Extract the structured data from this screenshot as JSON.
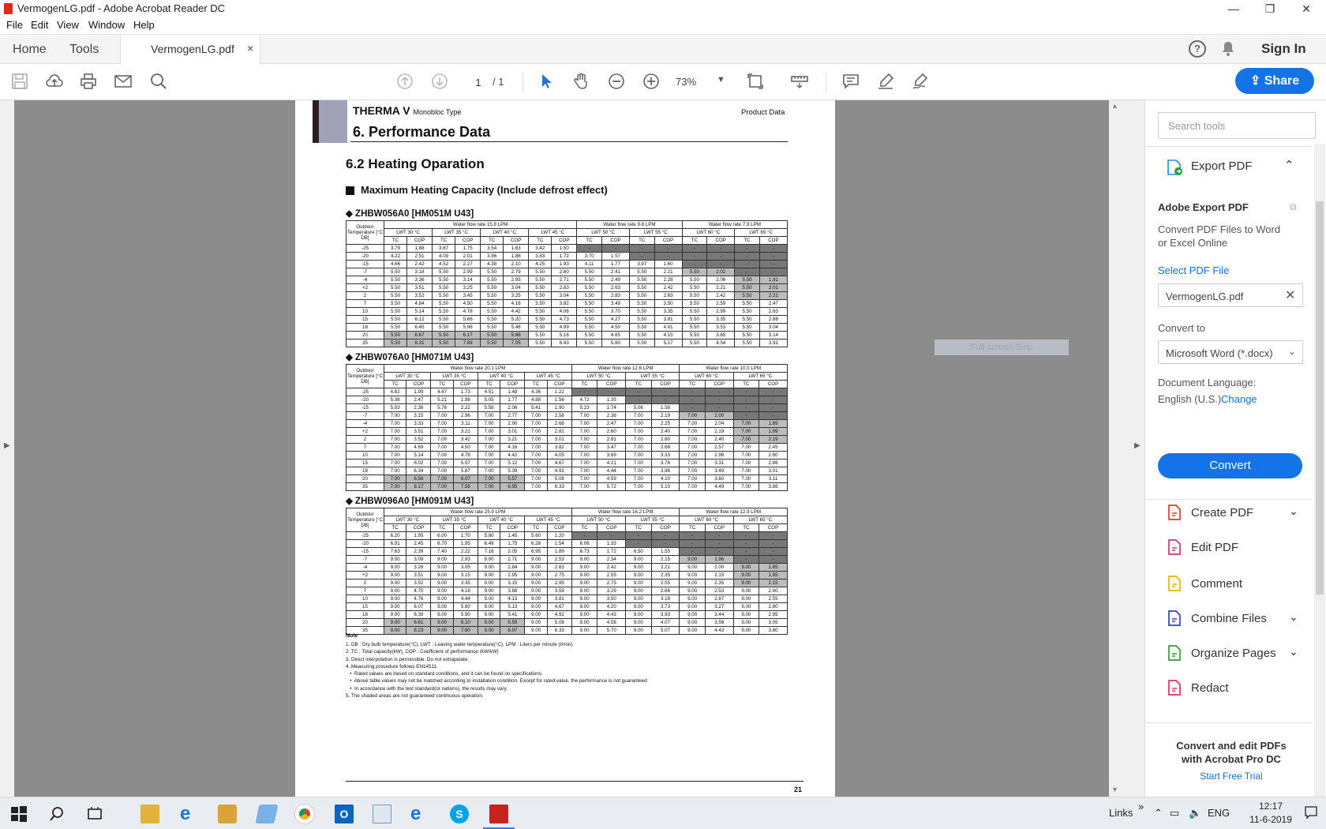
{
  "window": {
    "title": "VermogenLG.pdf - Adobe Acrobat Reader DC",
    "minimize": "—",
    "maximize": "❐",
    "close": "✕"
  },
  "menu": [
    "File",
    "Edit",
    "View",
    "Window",
    "Help"
  ],
  "tabs": {
    "home": "Home",
    "tools": "Tools",
    "doc": "VermogenLG.pdf",
    "close": "×"
  },
  "toolbar": {
    "page_current": "1",
    "page_total": "/ 1",
    "zoom": "73%",
    "share": "Share",
    "sign_in": "Sign In"
  },
  "panel": {
    "search_placeholder": "Search tools",
    "export_title": "Export PDF",
    "adobe_export_title": "Adobe Export PDF",
    "desc": "Convert PDF Files to Word or Excel Online",
    "select_file": "Select PDF File",
    "file_name": "VermogenLG.pdf",
    "convert_to": "Convert to",
    "format": "Microsoft Word (*.docx)",
    "doc_lang_label": "Document Language:",
    "doc_lang": "English (U.S.)",
    "change": "Change",
    "convert_btn": "Convert",
    "tools": [
      {
        "label": "Create PDF",
        "icon": "create-pdf-icon",
        "color": "#e03b2c",
        "chevron": true
      },
      {
        "label": "Edit PDF",
        "icon": "edit-pdf-icon",
        "color": "#c2397a",
        "chevron": false
      },
      {
        "label": "Comment",
        "icon": "comment-icon",
        "color": "#e8b400",
        "chevron": false
      },
      {
        "label": "Combine Files",
        "icon": "combine-files-icon",
        "color": "#3b3fc4",
        "chevron": true
      },
      {
        "label": "Organize Pages",
        "icon": "organize-pages-icon",
        "color": "#2e9e3a",
        "chevron": true
      },
      {
        "label": "Redact",
        "icon": "redact-icon",
        "color": "#d8305f",
        "chevron": false
      }
    ],
    "promo_title": "Convert and edit PDFs with Acrobat Pro DC",
    "promo_link": "Start Free Trial"
  },
  "overlay": {
    "snip": "Full-screen Snip"
  },
  "pdf": {
    "brand": "THERMA V",
    "brand_sub": "Monobloc Type",
    "product_data": "Product Data",
    "section": "6. Performance Data",
    "subsection": "6.2 Heating Oparation",
    "bullet_title": "Maximum Heating Capacity (Include defrost effect)",
    "page_number": "21",
    "temps": [
      "-25",
      "-20",
      "-15",
      "-7",
      "-4",
      "+2",
      "2",
      "7",
      "10",
      "15",
      "18",
      "20",
      "35"
    ],
    "lwt": [
      "LWT 30 °C",
      "LWT 35 °C",
      "LWT 40 °C",
      "LWT 45 °C",
      "LWT 50 °C",
      "LWT 55 °C",
      "LWT 60 °C",
      "LWT 65 °C"
    ],
    "col_tc": "TC",
    "col_cop": "COP",
    "outdoor_hdr": "Outdoor Temperature [°C DB]",
    "models": [
      {
        "name": "ZHBW056A0 [HM051M U43]",
        "flows": [
          "Water flow rate 15.8 LPM",
          "Water flow rate 9.8 LPM",
          "Water flow rate 7.9 LPM"
        ],
        "rows": [
          [
            "3.79",
            "1.88",
            "3.67",
            "1.75",
            "3.54",
            "1.63",
            "3.42",
            "1.50",
            "-",
            "-",
            "-",
            "-",
            "-",
            "-",
            "-",
            "-"
          ],
          [
            "4.22",
            "2.51",
            "4.09",
            "2.01",
            "3.96",
            "1.86",
            "3.83",
            "1.72",
            "3.70",
            "1.57",
            "-",
            "-",
            "-",
            "-",
            "-",
            "-"
          ],
          [
            "4.66",
            "2.42",
            "4.52",
            "2.27",
            "4.38",
            "2.10",
            "4.25",
            "1.93",
            "4.11",
            "1.77",
            "3.97",
            "1.60",
            "-",
            "-",
            "-",
            "-"
          ],
          [
            "5.50",
            "3.18",
            "5.50",
            "2.99",
            "5.50",
            "2.79",
            "5.50",
            "2.60",
            "5.50",
            "2.41",
            "5.50",
            "2.21",
            "5.50",
            "2.02",
            "-",
            "-"
          ],
          [
            "5.50",
            "3.36",
            "5.50",
            "3.14",
            "5.50",
            "2.93",
            "5.50",
            "2.71",
            "5.50",
            "2.49",
            "5.50",
            "2.28",
            "5.50",
            "2.06",
            "5.50",
            "1.91"
          ],
          [
            "5.50",
            "3.51",
            "5.50",
            "3.25",
            "5.50",
            "3.04",
            "5.50",
            "2.83",
            "5.50",
            "2.63",
            "5.50",
            "2.42",
            "5.50",
            "2.21",
            "5.50",
            "2.01"
          ],
          [
            "5.50",
            "3.52",
            "5.50",
            "3.45",
            "5.50",
            "3.25",
            "5.50",
            "3.04",
            "5.50",
            "2.83",
            "5.50",
            "2.63",
            "5.50",
            "2.42",
            "5.50",
            "2.21"
          ],
          [
            "5.50",
            "4.84",
            "5.50",
            "4.50",
            "5.50",
            "4.16",
            "5.50",
            "3.82",
            "5.50",
            "3.49",
            "5.50",
            "3.50",
            "5.50",
            "2.59",
            "5.50",
            "2.47"
          ],
          [
            "5.50",
            "5.14",
            "5.50",
            "4.78",
            "5.50",
            "4.42",
            "5.50",
            "4.06",
            "5.50",
            "3.70",
            "5.50",
            "3.35",
            "5.50",
            "2.99",
            "5.50",
            "2.63"
          ],
          [
            "5.50",
            "6.12",
            "5.50",
            "5.66",
            "5.50",
            "5.20",
            "5.50",
            "4.73",
            "5.50",
            "4.27",
            "5.50",
            "3.81",
            "5.50",
            "3.35",
            "5.50",
            "2.88"
          ],
          [
            "5.50",
            "6.45",
            "5.50",
            "5.96",
            "5.50",
            "5.48",
            "5.50",
            "4.99",
            "5.50",
            "4.50",
            "5.50",
            "4.01",
            "5.50",
            "3.53",
            "5.50",
            "3.04"
          ],
          [
            "5.50",
            "6.67",
            "5.50",
            "6.17",
            "5.50",
            "5.66",
            "5.50",
            "5.16",
            "5.50",
            "4.65",
            "5.50",
            "4.15",
            "5.50",
            "3.65",
            "5.50",
            "3.14"
          ],
          [
            "5.50",
            "8.31",
            "5.50",
            "7.68",
            "5.50",
            "7.05",
            "5.50",
            "6.43",
            "5.50",
            "5.80",
            "5.50",
            "5.17",
            "5.50",
            "4.54",
            "5.50",
            "3.91"
          ]
        ]
      },
      {
        "name": "ZHBW076A0 [HM071M U43]",
        "flows": [
          "Water flow rate 20.1 LPM",
          "Water flow rate 12.6 LPM",
          "Water flow rate 10.0 LPM"
        ],
        "rows": [
          [
            "4.82",
            "1.99",
            "4.67",
            "1.73",
            "4.51",
            "1.48",
            "4.36",
            "1.22",
            "-",
            "-",
            "-",
            "-",
            "-",
            "-",
            "-",
            "-"
          ],
          [
            "5.38",
            "2.47",
            "5.21",
            "1.98",
            "5.05",
            "1.77",
            "4.88",
            "1.56",
            "4.72",
            "1.35",
            "-",
            "-",
            "-",
            "-",
            "-",
            "-"
          ],
          [
            "5.93",
            "2.38",
            "5.76",
            "2.22",
            "5.58",
            "2.06",
            "5.41",
            "1.90",
            "5.23",
            "1.74",
            "5.06",
            "1.58",
            "-",
            "-",
            "-",
            "-"
          ],
          [
            "7.00",
            "3.15",
            "7.00",
            "2.96",
            "7.00",
            "2.77",
            "7.00",
            "2.58",
            "7.00",
            "2.38",
            "7.00",
            "2.19",
            "7.00",
            "2.00",
            "-",
            "-"
          ],
          [
            "7.00",
            "3.33",
            "7.00",
            "3.11",
            "7.00",
            "2.90",
            "7.00",
            "2.68",
            "7.00",
            "2.47",
            "7.00",
            "2.25",
            "7.00",
            "2.04",
            "7.00",
            "1.89"
          ],
          [
            "7.00",
            "3.51",
            "7.00",
            "3.21",
            "7.00",
            "3.01",
            "7.00",
            "2.81",
            "7.00",
            "2.60",
            "7.00",
            "2.40",
            "7.00",
            "2.19",
            "7.00",
            "1.99"
          ],
          [
            "7.00",
            "3.52",
            "7.00",
            "3.42",
            "7.00",
            "3.21",
            "7.00",
            "3.01",
            "7.00",
            "2.81",
            "7.00",
            "2.60",
            "7.00",
            "2.40",
            "7.00",
            "2.19"
          ],
          [
            "7.00",
            "4.69",
            "7.00",
            "4.50",
            "7.00",
            "4.16",
            "7.00",
            "3.82",
            "7.00",
            "3.47",
            "7.00",
            "2.68",
            "7.00",
            "2.57",
            "7.00",
            "2.45"
          ],
          [
            "7.00",
            "5.14",
            "7.00",
            "4.78",
            "7.00",
            "4.42",
            "7.00",
            "4.05",
            "7.00",
            "3.69",
            "7.00",
            "3.33",
            "7.00",
            "2.96",
            "7.00",
            "2.60"
          ],
          [
            "7.00",
            "6.02",
            "7.00",
            "5.57",
            "7.00",
            "5.12",
            "7.00",
            "4.67",
            "7.00",
            "4.21",
            "7.00",
            "3.76",
            "7.00",
            "3.31",
            "7.00",
            "2.86"
          ],
          [
            "7.00",
            "6.34",
            "7.00",
            "5.87",
            "7.00",
            "5.39",
            "7.00",
            "4.92",
            "7.00",
            "4.44",
            "7.00",
            "3.96",
            "7.00",
            "3.49",
            "7.00",
            "3.01"
          ],
          [
            "7.00",
            "6.56",
            "7.00",
            "6.07",
            "7.00",
            "5.57",
            "7.00",
            "5.08",
            "7.00",
            "4.59",
            "7.00",
            "4.10",
            "7.00",
            "3.60",
            "7.00",
            "3.11"
          ],
          [
            "7.00",
            "8.17",
            "7.00",
            "7.56",
            "7.00",
            "6.95",
            "7.00",
            "6.33",
            "7.00",
            "5.72",
            "7.00",
            "5.10",
            "7.00",
            "4.49",
            "7.00",
            "3.88"
          ]
        ]
      },
      {
        "name": "ZHBW096A0 [HM091M U43]",
        "flows": [
          "Water flow rate 25.9 LPM",
          "Water flow rate 16.2 LPM",
          "Water flow rate 12.9 LPM"
        ],
        "rows": [
          [
            "6.20",
            "1.95",
            "6.00",
            "1.70",
            "5.80",
            "1.45",
            "5.60",
            "1.20",
            "-",
            "-",
            "-",
            "-",
            "-",
            "-",
            "-",
            "-"
          ],
          [
            "6.91",
            "2.45",
            "6.70",
            "1.95",
            "6.49",
            "1.75",
            "6.28",
            "1.54",
            "6.06",
            "1.33",
            "-",
            "-",
            "-",
            "-",
            "-",
            "-"
          ],
          [
            "7.63",
            "2.39",
            "7.40",
            "2.22",
            "7.18",
            "2.05",
            "6.95",
            "1.89",
            "6.73",
            "1.72",
            "6.50",
            "1.55",
            "-",
            "-",
            "-",
            "-"
          ],
          [
            "9.00",
            "3.09",
            "9.00",
            "2.93",
            "9.00",
            "2.71",
            "9.00",
            "2.53",
            "9.00",
            "2.34",
            "9.00",
            "2.15",
            "9.00",
            "1.96",
            "-",
            "-"
          ],
          [
            "9.00",
            "3.26",
            "9.00",
            "3.05",
            "9.00",
            "2.84",
            "9.00",
            "2.63",
            "9.00",
            "2.42",
            "9.00",
            "2.21",
            "9.00",
            "2.00",
            "9.00",
            "1.85"
          ],
          [
            "9.00",
            "3.51",
            "9.00",
            "3.15",
            "9.00",
            "2.95",
            "9.00",
            "2.75",
            "9.00",
            "2.55",
            "9.00",
            "2.35",
            "9.00",
            "2.15",
            "9.00",
            "1.95"
          ],
          [
            "9.00",
            "3.52",
            "9.00",
            "3.35",
            "9.00",
            "3.15",
            "9.00",
            "2.95",
            "9.00",
            "2.75",
            "9.00",
            "2.55",
            "9.00",
            "2.35",
            "9.00",
            "2.15"
          ],
          [
            "9.00",
            "4.70",
            "9.00",
            "4.18",
            "9.00",
            "3.88",
            "9.00",
            "3.59",
            "9.00",
            "3.29",
            "9.00",
            "2.66",
            "9.00",
            "2.53",
            "9.00",
            "2.40"
          ],
          [
            "9.00",
            "4.76",
            "9.00",
            "4.44",
            "9.00",
            "4.13",
            "9.00",
            "3.81",
            "9.00",
            "3.50",
            "9.00",
            "3.18",
            "9.00",
            "2.87",
            "9.00",
            "2.55"
          ],
          [
            "9.00",
            "6.07",
            "9.00",
            "5.60",
            "9.00",
            "5.13",
            "9.00",
            "4.67",
            "9.00",
            "4.20",
            "9.00",
            "3.73",
            "9.00",
            "3.27",
            "9.00",
            "2.80"
          ],
          [
            "9.00",
            "6.39",
            "9.00",
            "5.90",
            "9.00",
            "5.41",
            "9.00",
            "4.92",
            "9.00",
            "4.43",
            "9.00",
            "3.93",
            "9.00",
            "3.44",
            "9.00",
            "2.95"
          ],
          [
            "9.00",
            "6.61",
            "9.00",
            "6.10",
            "9.00",
            "5.59",
            "9.00",
            "5.08",
            "9.00",
            "4.58",
            "9.00",
            "4.07",
            "9.00",
            "3.56",
            "9.00",
            "3.05"
          ],
          [
            "9.00",
            "8.23",
            "9.00",
            "7.60",
            "9.00",
            "6.97",
            "9.00",
            "6.33",
            "9.00",
            "5.70",
            "9.00",
            "5.07",
            "9.00",
            "4.43",
            "9.00",
            "3.80"
          ]
        ]
      }
    ],
    "note_title": "Note",
    "notes": [
      "1. DB : Dry bulb temperature(°C), LWT : Leaving water temperature(°C), LPM : Liters per minute (ℓ/min)",
      "2. TC : Total capacity(kW), COP : Coefficient of performance (kW/kW)",
      "3. Direct interpolation is permissible. Do not extrapolate.",
      "4. Measuring procedure follows EN14511.",
      "   •  Rated values are based on standard conditions, and it can be found on specifications.",
      "   •  Above table values may not be matched according to installation condition. Except for rated value, the performance is not guaranteed.",
      "   •  In accordance with the test standard(or nations), the results may vary.",
      "5. The shaded areas are not guaranteed continuous operation."
    ]
  },
  "taskbar": {
    "links": "Links",
    "chevron": "»",
    "lang": "ENG",
    "time": "12:17",
    "date": "11-6-2019"
  }
}
